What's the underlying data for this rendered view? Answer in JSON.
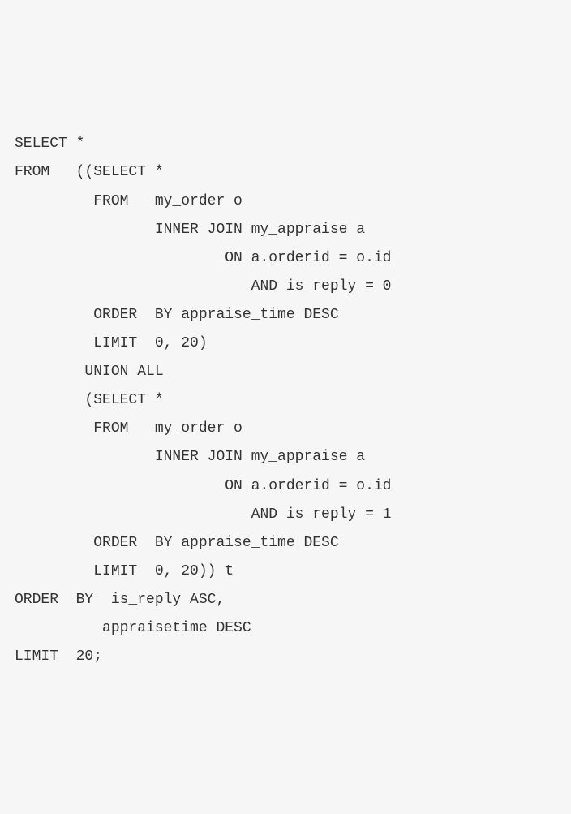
{
  "code": {
    "lines": [
      "SELECT *",
      "FROM   ((SELECT *",
      "         FROM   my_order o",
      "                INNER JOIN my_appraise a",
      "                        ON a.orderid = o.id",
      "                           AND is_reply = 0",
      "         ORDER  BY appraise_time DESC",
      "         LIMIT  0, 20)",
      "        UNION ALL",
      "        (SELECT *",
      "         FROM   my_order o",
      "                INNER JOIN my_appraise a",
      "                        ON a.orderid = o.id",
      "                           AND is_reply = 1",
      "         ORDER  BY appraise_time DESC",
      "         LIMIT  0, 20)) t",
      "ORDER  BY  is_reply ASC,",
      "          appraisetime DESC",
      "LIMIT  20;"
    ]
  }
}
